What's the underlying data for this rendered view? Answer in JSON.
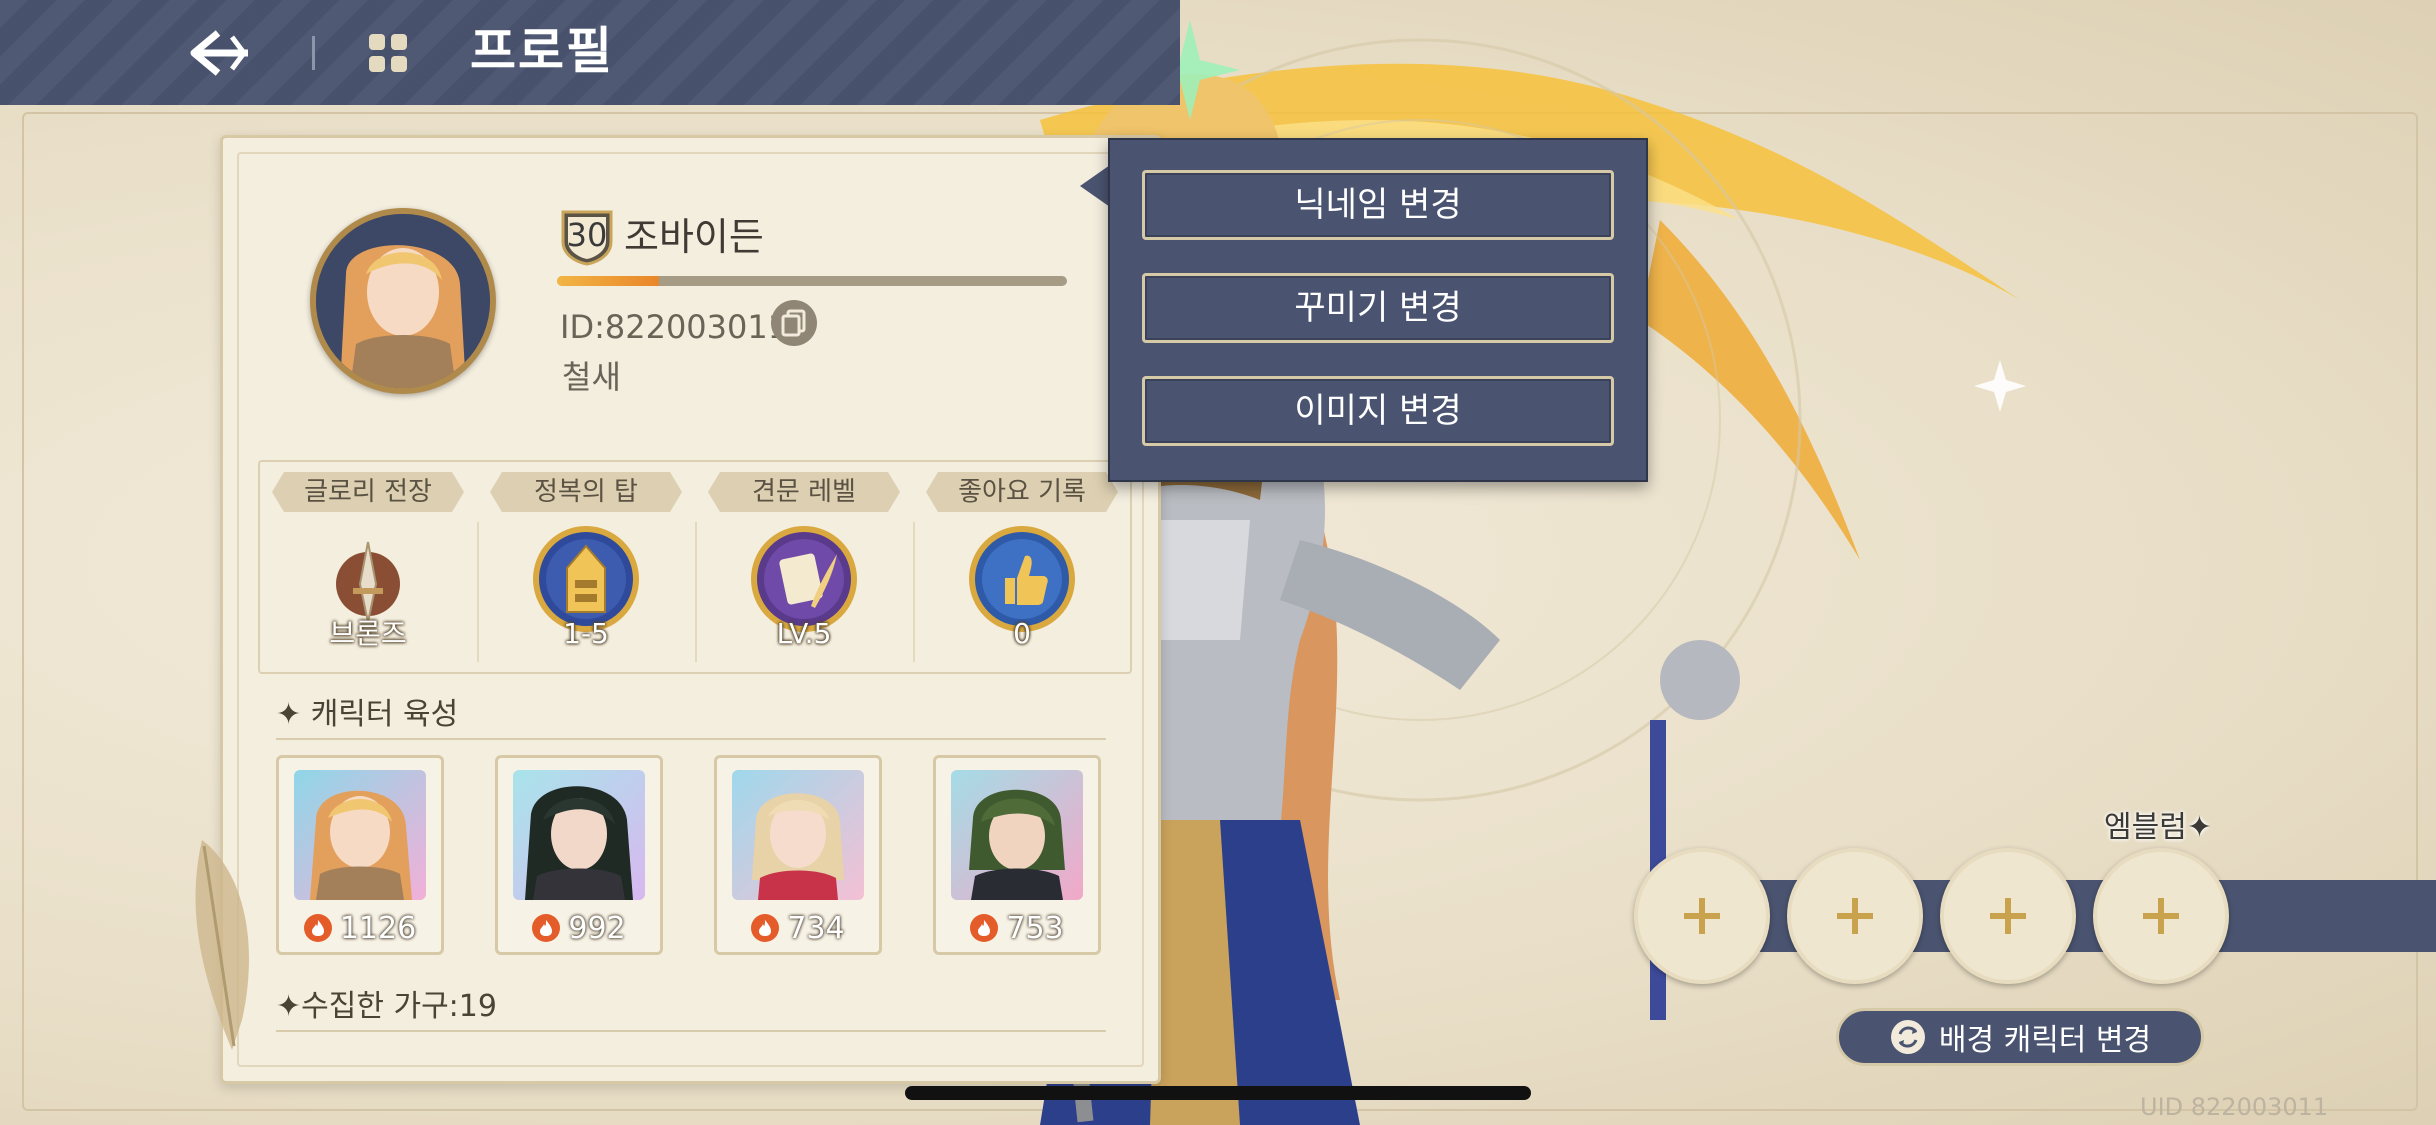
{
  "header": {
    "title": "프로필",
    "back_icon": "back-arrow-icon",
    "menu_icon": "clover-menu-icon"
  },
  "profile": {
    "level": "30",
    "nickname": "조바이든",
    "exp_progress": 0.2,
    "id_text": "ID:822003011",
    "title": "철새"
  },
  "stats": [
    {
      "label": "글로리 전장",
      "value": "브론즈",
      "icon": "sword-emblem-icon"
    },
    {
      "label": "정복의 탑",
      "value": "1-5",
      "icon": "tower-medal-icon"
    },
    {
      "label": "견문 레벨",
      "value": "LV.5",
      "icon": "scroll-quill-medal-icon"
    },
    {
      "label": "좋아요 기록",
      "value": "0",
      "icon": "thumbs-up-medal-icon"
    }
  ],
  "character_section": {
    "title": "캐릭터 육성"
  },
  "characters": [
    {
      "power": "1126"
    },
    {
      "power": "992"
    },
    {
      "power": "734"
    },
    {
      "power": "753"
    }
  ],
  "furniture_section": {
    "title": "수집한 가구:19"
  },
  "popup_menu": {
    "items": [
      "닉네임 변경",
      "꾸미기 변경",
      "이미지 변경"
    ]
  },
  "emblem": {
    "label": "엠블럼"
  },
  "bg_change": {
    "label": "배경 캐릭터 변경"
  },
  "footer": {
    "uid": "UID 822003011"
  },
  "colors": {
    "navy": "#4a5470",
    "parchment": "#f4eedf",
    "gold": "#d6c9a8",
    "exp": "#f2b544"
  }
}
